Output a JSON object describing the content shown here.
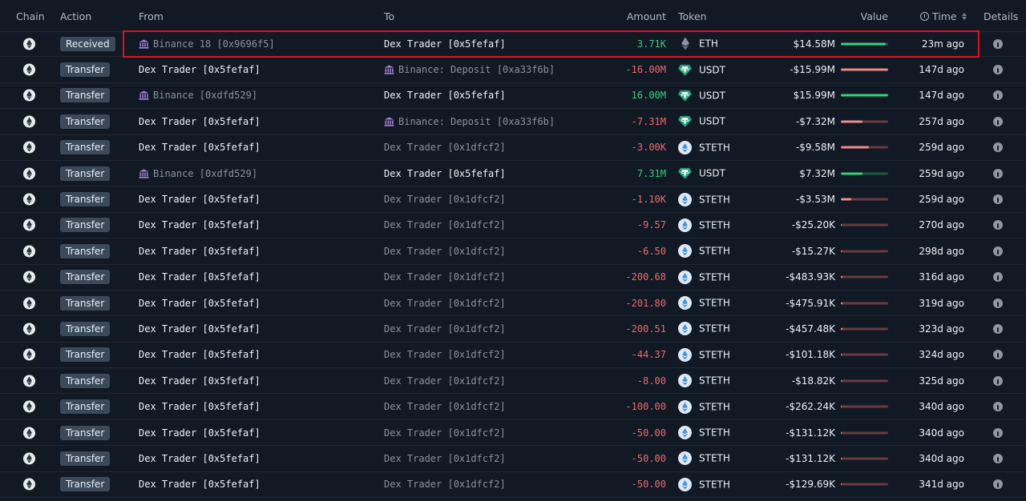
{
  "headers": {
    "chain": "Chain",
    "action": "Action",
    "from": "From",
    "to": "To",
    "amount": "Amount",
    "token": "Token",
    "value": "Value",
    "time": "Time",
    "details": "Details"
  },
  "colors": {
    "positive": "#34d27a",
    "negative": "#ec6a6a",
    "highlight": "#e0121b",
    "background": "#111925"
  },
  "rows": [
    {
      "action": "Received",
      "from": "Binance 18 [0x9696f5]",
      "from_entity": "exchange",
      "from_dim": true,
      "to": "Dex Trader [0x5fefaf]",
      "to_entity": "none",
      "to_dim": false,
      "amount": "3.71K",
      "sign": "pos",
      "token": "ETH",
      "token_icon": "eth-icon",
      "value": "$14.58M",
      "bar_fraction": 0.95,
      "time": "23m ago"
    },
    {
      "action": "Transfer",
      "from": "Dex Trader [0x5fefaf]",
      "from_entity": "none",
      "from_dim": false,
      "to": "Binance: Deposit [0xa33f6b]",
      "to_entity": "exchange",
      "to_dim": true,
      "amount": "-16.00M",
      "sign": "neg",
      "token": "USDT",
      "token_icon": "usdt-icon",
      "value": "-$15.99M",
      "bar_fraction": 1.0,
      "time": "147d ago"
    },
    {
      "action": "Transfer",
      "from": "Binance [0xdfd529]",
      "from_entity": "exchange",
      "from_dim": true,
      "to": "Dex Trader [0x5fefaf]",
      "to_entity": "none",
      "to_dim": false,
      "amount": "16.00M",
      "sign": "pos",
      "token": "USDT",
      "token_icon": "usdt-icon",
      "value": "$15.99M",
      "bar_fraction": 1.0,
      "time": "147d ago"
    },
    {
      "action": "Transfer",
      "from": "Dex Trader [0x5fefaf]",
      "from_entity": "none",
      "from_dim": false,
      "to": "Binance: Deposit [0xa33f6b]",
      "to_entity": "exchange",
      "to_dim": true,
      "amount": "-7.31M",
      "sign": "neg",
      "token": "USDT",
      "token_icon": "usdt-icon",
      "value": "-$7.32M",
      "bar_fraction": 0.46,
      "time": "257d ago"
    },
    {
      "action": "Transfer",
      "from": "Dex Trader [0x5fefaf]",
      "from_entity": "none",
      "from_dim": false,
      "to": "Dex Trader [0x1dfcf2]",
      "to_entity": "none",
      "to_dim": true,
      "amount": "-3.00K",
      "sign": "neg",
      "token": "STETH",
      "token_icon": "steth-icon",
      "value": "-$9.58M",
      "bar_fraction": 0.6,
      "time": "259d ago"
    },
    {
      "action": "Transfer",
      "from": "Binance [0xdfd529]",
      "from_entity": "exchange",
      "from_dim": true,
      "to": "Dex Trader [0x5fefaf]",
      "to_entity": "none",
      "to_dim": false,
      "amount": "7.31M",
      "sign": "pos",
      "token": "USDT",
      "token_icon": "usdt-icon",
      "value": "$7.32M",
      "bar_fraction": 0.46,
      "time": "259d ago"
    },
    {
      "action": "Transfer",
      "from": "Dex Trader [0x5fefaf]",
      "from_entity": "none",
      "from_dim": false,
      "to": "Dex Trader [0x1dfcf2]",
      "to_entity": "none",
      "to_dim": true,
      "amount": "-1.10K",
      "sign": "neg",
      "token": "STETH",
      "token_icon": "steth-icon",
      "value": "-$3.53M",
      "bar_fraction": 0.22,
      "time": "259d ago"
    },
    {
      "action": "Transfer",
      "from": "Dex Trader [0x5fefaf]",
      "from_entity": "none",
      "from_dim": false,
      "to": "Dex Trader [0x1dfcf2]",
      "to_entity": "none",
      "to_dim": true,
      "amount": "-9.57",
      "sign": "neg",
      "token": "STETH",
      "token_icon": "steth-icon",
      "value": "-$25.20K",
      "bar_fraction": 0.01,
      "time": "270d ago"
    },
    {
      "action": "Transfer",
      "from": "Dex Trader [0x5fefaf]",
      "from_entity": "none",
      "from_dim": false,
      "to": "Dex Trader [0x1dfcf2]",
      "to_entity": "none",
      "to_dim": true,
      "amount": "-6.50",
      "sign": "neg",
      "token": "STETH",
      "token_icon": "steth-icon",
      "value": "-$15.27K",
      "bar_fraction": 0.01,
      "time": "298d ago"
    },
    {
      "action": "Transfer",
      "from": "Dex Trader [0x5fefaf]",
      "from_entity": "none",
      "from_dim": false,
      "to": "Dex Trader [0x1dfcf2]",
      "to_entity": "none",
      "to_dim": true,
      "amount": "-200.68",
      "sign": "neg",
      "token": "STETH",
      "token_icon": "steth-icon",
      "value": "-$483.93K",
      "bar_fraction": 0.03,
      "time": "316d ago"
    },
    {
      "action": "Transfer",
      "from": "Dex Trader [0x5fefaf]",
      "from_entity": "none",
      "from_dim": false,
      "to": "Dex Trader [0x1dfcf2]",
      "to_entity": "none",
      "to_dim": true,
      "amount": "-201.80",
      "sign": "neg",
      "token": "STETH",
      "token_icon": "steth-icon",
      "value": "-$475.91K",
      "bar_fraction": 0.03,
      "time": "319d ago"
    },
    {
      "action": "Transfer",
      "from": "Dex Trader [0x5fefaf]",
      "from_entity": "none",
      "from_dim": false,
      "to": "Dex Trader [0x1dfcf2]",
      "to_entity": "none",
      "to_dim": true,
      "amount": "-200.51",
      "sign": "neg",
      "token": "STETH",
      "token_icon": "steth-icon",
      "value": "-$457.48K",
      "bar_fraction": 0.03,
      "time": "323d ago"
    },
    {
      "action": "Transfer",
      "from": "Dex Trader [0x5fefaf]",
      "from_entity": "none",
      "from_dim": false,
      "to": "Dex Trader [0x1dfcf2]",
      "to_entity": "none",
      "to_dim": true,
      "amount": "-44.37",
      "sign": "neg",
      "token": "STETH",
      "token_icon": "steth-icon",
      "value": "-$101.18K",
      "bar_fraction": 0.01,
      "time": "324d ago"
    },
    {
      "action": "Transfer",
      "from": "Dex Trader [0x5fefaf]",
      "from_entity": "none",
      "from_dim": false,
      "to": "Dex Trader [0x1dfcf2]",
      "to_entity": "none",
      "to_dim": true,
      "amount": "-8.00",
      "sign": "neg",
      "token": "STETH",
      "token_icon": "steth-icon",
      "value": "-$18.82K",
      "bar_fraction": 0.01,
      "time": "325d ago"
    },
    {
      "action": "Transfer",
      "from": "Dex Trader [0x5fefaf]",
      "from_entity": "none",
      "from_dim": false,
      "to": "Dex Trader [0x1dfcf2]",
      "to_entity": "none",
      "to_dim": true,
      "amount": "-100.00",
      "sign": "neg",
      "token": "STETH",
      "token_icon": "steth-icon",
      "value": "-$262.24K",
      "bar_fraction": 0.02,
      "time": "340d ago"
    },
    {
      "action": "Transfer",
      "from": "Dex Trader [0x5fefaf]",
      "from_entity": "none",
      "from_dim": false,
      "to": "Dex Trader [0x1dfcf2]",
      "to_entity": "none",
      "to_dim": true,
      "amount": "-50.00",
      "sign": "neg",
      "token": "STETH",
      "token_icon": "steth-icon",
      "value": "-$131.12K",
      "bar_fraction": 0.01,
      "time": "340d ago"
    },
    {
      "action": "Transfer",
      "from": "Dex Trader [0x5fefaf]",
      "from_entity": "none",
      "from_dim": false,
      "to": "Dex Trader [0x1dfcf2]",
      "to_entity": "none",
      "to_dim": true,
      "amount": "-50.00",
      "sign": "neg",
      "token": "STETH",
      "token_icon": "steth-icon",
      "value": "-$131.12K",
      "bar_fraction": 0.01,
      "time": "340d ago"
    },
    {
      "action": "Transfer",
      "from": "Dex Trader [0x5fefaf]",
      "from_entity": "none",
      "from_dim": false,
      "to": "Dex Trader [0x1dfcf2]",
      "to_entity": "none",
      "to_dim": true,
      "amount": "-50.00",
      "sign": "neg",
      "token": "STETH",
      "token_icon": "steth-icon",
      "value": "-$129.69K",
      "bar_fraction": 0.01,
      "time": "341d ago"
    }
  ]
}
